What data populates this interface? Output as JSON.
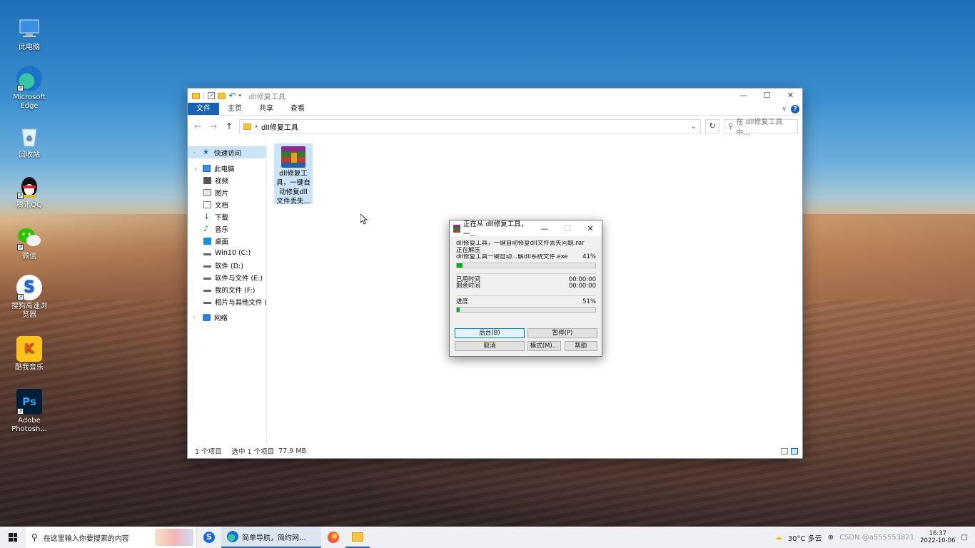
{
  "desktop": {
    "icons": [
      {
        "label": "此电脑",
        "icon": "computer-icon"
      },
      {
        "label": "Microsoft Edge",
        "icon": "edge-icon"
      },
      {
        "label": "回收站",
        "icon": "recycle-bin-icon"
      },
      {
        "label": "腾讯QQ",
        "icon": "qq-icon"
      },
      {
        "label": "微信",
        "icon": "wechat-icon"
      },
      {
        "label": "搜狗高速浏览器",
        "icon": "sogou-browser-icon"
      },
      {
        "label": "酷我音乐",
        "icon": "kuwo-music-icon"
      },
      {
        "label": "Adobe Photosh...",
        "icon": "photoshop-icon"
      }
    ]
  },
  "explorer": {
    "title": "dll修复工具",
    "controls": {
      "minimize": "—",
      "maximize": "☐",
      "close": "✕"
    },
    "ribbon_tabs": [
      "文件",
      "主页",
      "共享",
      "查看"
    ],
    "address": {
      "separator": "›",
      "path": "dll修复工具"
    },
    "search_placeholder": "在 dll修复工具 中...",
    "nav_pane": [
      {
        "label": "快速访问",
        "icon": "star-icon"
      },
      {
        "label": "此电脑",
        "icon": "computer-icon"
      },
      {
        "label": "视频",
        "icon": "video-icon"
      },
      {
        "label": "图片",
        "icon": "picture-icon"
      },
      {
        "label": "文档",
        "icon": "document-icon"
      },
      {
        "label": "下载",
        "icon": "download-icon"
      },
      {
        "label": "音乐",
        "icon": "music-icon"
      },
      {
        "label": "桌面",
        "icon": "desktop-icon"
      },
      {
        "label": "Win10 (C:)",
        "icon": "drive-icon"
      },
      {
        "label": "软件 (D:)",
        "icon": "drive-icon"
      },
      {
        "label": "软件与文件 (E:)",
        "icon": "drive-icon"
      },
      {
        "label": "我的文件 (F:)",
        "icon": "drive-icon"
      },
      {
        "label": "相片与其他文件 (G:",
        "icon": "drive-icon"
      },
      {
        "label": "网络",
        "icon": "network-icon"
      }
    ],
    "file": {
      "name": "dll修复工具，一键自动修复dll文件丢失..."
    },
    "status": {
      "count": "1 个项目",
      "selected": "选中 1 个项目",
      "size": "77.9 MB"
    }
  },
  "dialog": {
    "title": "正在从 dll修复工具，一...",
    "archive": "dll修复工具，一键自动修复dll文件丢失问题.rar",
    "action": "正在解压",
    "current_file": "dll修复工具一键自动...解dll系统文件.exe",
    "file_percent": "41%",
    "file_progress": 0.41,
    "elapsed_label": "已用时间",
    "elapsed": "00:00:00",
    "remaining_label": "剩余时间",
    "remaining": "00:00:00",
    "total_label": "进度",
    "total_percent": "51%",
    "total_progress": 0.51,
    "buttons": {
      "background": "后台(B)",
      "pause": "暂停(P)",
      "cancel": "取消",
      "mode": "模式(M)...",
      "help": "帮助"
    }
  },
  "taskbar": {
    "search_placeholder": "在这里输入你要搜索的内容",
    "active_app": "简单导航，简约网...",
    "weather": "30°C 多云",
    "time": "16:37",
    "date": "2022-10-06",
    "watermark": "CSDN @a555553821"
  }
}
